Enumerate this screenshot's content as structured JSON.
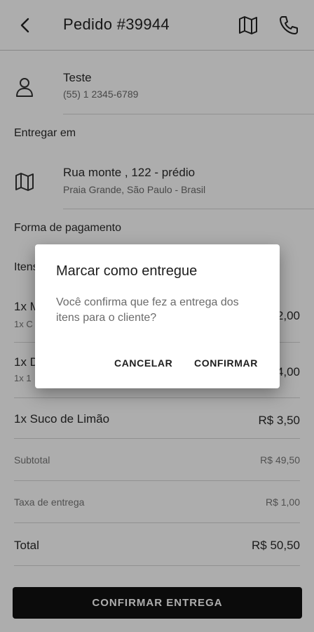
{
  "header": {
    "title": "Pedido #39944"
  },
  "customer": {
    "name": "Teste",
    "phone": "(55) 1 2345-6789"
  },
  "delivery": {
    "section_label": "Entregar em",
    "address": "Rua monte , 122 - prédio",
    "city": "Praia Grande, São Paulo - Brasil"
  },
  "payment": {
    "section_label": "Forma de pagamento"
  },
  "items": {
    "section_label": "Itens",
    "list": [
      {
        "name": "1x M",
        "sub": "1x C",
        "price": "2,00"
      },
      {
        "name": "1x D",
        "sub": "1x 1",
        "price": "4,00"
      },
      {
        "name": "1x Suco de Limão",
        "sub": "",
        "price": "R$ 3,50"
      }
    ]
  },
  "summary": {
    "subtotal_label": "Subtotal",
    "subtotal_value": "R$ 49,50",
    "fee_label": "Taxa de entrega",
    "fee_value": "R$ 1,00",
    "total_label": "Total",
    "total_value": "R$ 50,50"
  },
  "cta": {
    "label": "CONFIRMAR ENTREGA"
  },
  "dialog": {
    "title": "Marcar como entregue",
    "message": "Você confirma que fez a entrega dos itens para o cliente?",
    "cancel_label": "CANCELAR",
    "confirm_label": "CONFIRMAR"
  },
  "icons": {
    "back": "arrow-left-icon",
    "map": "map-icon",
    "phone": "phone-icon",
    "person": "person-icon"
  },
  "colors": {
    "cta_background": "#111111",
    "scrim": "rgba(0,0,0,0.32)"
  }
}
